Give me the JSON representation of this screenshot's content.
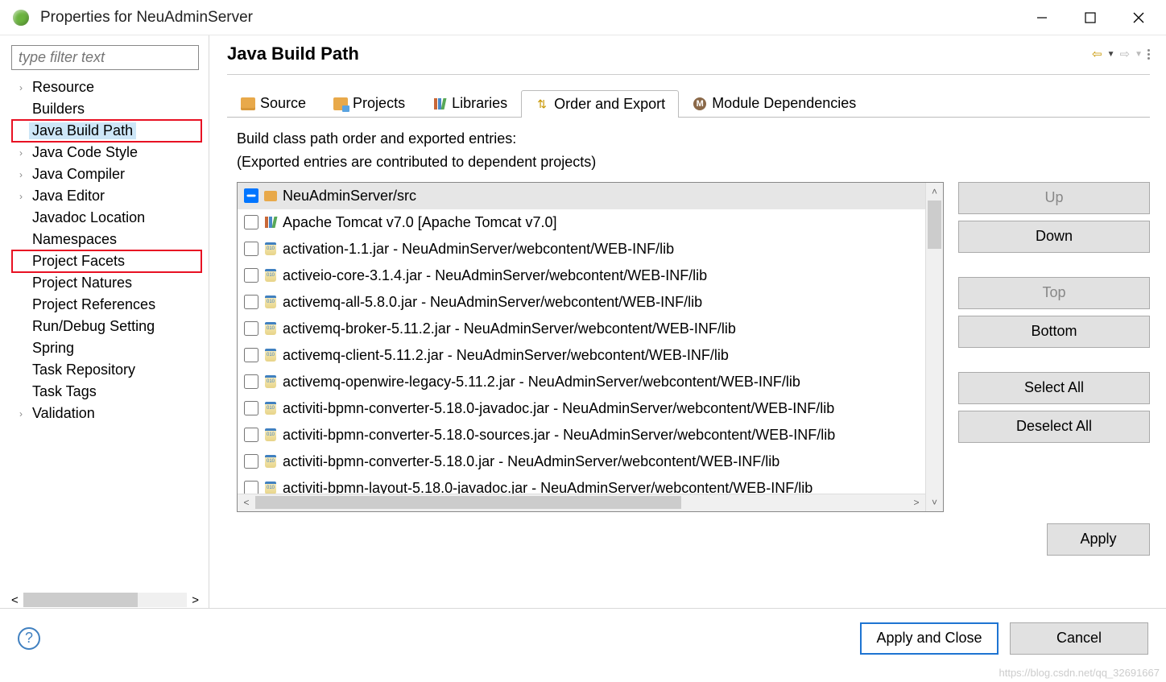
{
  "window": {
    "title": "Properties for NeuAdminServer"
  },
  "sidebar": {
    "filter_placeholder": "type filter text",
    "items": [
      {
        "label": "Resource",
        "expandable": true
      },
      {
        "label": "Builders",
        "expandable": false
      },
      {
        "label": "Java Build Path",
        "expandable": false,
        "selected": true,
        "highlight": true
      },
      {
        "label": "Java Code Style",
        "expandable": true
      },
      {
        "label": "Java Compiler",
        "expandable": true
      },
      {
        "label": "Java Editor",
        "expandable": true
      },
      {
        "label": "Javadoc Location",
        "expandable": false
      },
      {
        "label": "Namespaces",
        "expandable": false
      },
      {
        "label": "Project Facets",
        "expandable": false,
        "highlight": true
      },
      {
        "label": "Project Natures",
        "expandable": false
      },
      {
        "label": "Project References",
        "expandable": false
      },
      {
        "label": "Run/Debug Setting",
        "expandable": false
      },
      {
        "label": "Spring",
        "expandable": false
      },
      {
        "label": "Task Repository",
        "expandable": false
      },
      {
        "label": "Task Tags",
        "expandable": false
      },
      {
        "label": "Validation",
        "expandable": true
      }
    ]
  },
  "page": {
    "title": "Java Build Path",
    "tabs": [
      {
        "label": "Source",
        "icon": "folder"
      },
      {
        "label": "Projects",
        "icon": "projects"
      },
      {
        "label": "Libraries",
        "icon": "lib"
      },
      {
        "label": "Order and Export",
        "icon": "order",
        "active": true
      },
      {
        "label": "Module Dependencies",
        "icon": "mod"
      }
    ],
    "instruction_line1": "Build class path order and exported entries:",
    "instruction_line2": "(Exported entries are contributed to dependent projects)"
  },
  "entries": [
    {
      "label": "NeuAdminServer/src",
      "icon": "pkg",
      "chk": "indet",
      "sel": true
    },
    {
      "label": "Apache Tomcat v7.0 [Apache Tomcat v7.0]",
      "icon": "lib",
      "chk": "off"
    },
    {
      "label": "activation-1.1.jar - NeuAdminServer/webcontent/WEB-INF/lib",
      "icon": "jar",
      "chk": "off"
    },
    {
      "label": "activeio-core-3.1.4.jar - NeuAdminServer/webcontent/WEB-INF/lib",
      "icon": "jar",
      "chk": "off"
    },
    {
      "label": "activemq-all-5.8.0.jar - NeuAdminServer/webcontent/WEB-INF/lib",
      "icon": "jar",
      "chk": "off"
    },
    {
      "label": "activemq-broker-5.11.2.jar - NeuAdminServer/webcontent/WEB-INF/lib",
      "icon": "jar",
      "chk": "off"
    },
    {
      "label": "activemq-client-5.11.2.jar - NeuAdminServer/webcontent/WEB-INF/lib",
      "icon": "jar",
      "chk": "off"
    },
    {
      "label": "activemq-openwire-legacy-5.11.2.jar - NeuAdminServer/webcontent/WEB-INF/lib",
      "icon": "jar",
      "chk": "off"
    },
    {
      "label": "activiti-bpmn-converter-5.18.0-javadoc.jar - NeuAdminServer/webcontent/WEB-INF/lib",
      "icon": "jar",
      "chk": "off"
    },
    {
      "label": "activiti-bpmn-converter-5.18.0-sources.jar - NeuAdminServer/webcontent/WEB-INF/lib",
      "icon": "jar",
      "chk": "off"
    },
    {
      "label": "activiti-bpmn-converter-5.18.0.jar - NeuAdminServer/webcontent/WEB-INF/lib",
      "icon": "jar",
      "chk": "off"
    },
    {
      "label": "activiti-bpmn-layout-5.18.0-javadoc.jar - NeuAdminServer/webcontent/WEB-INF/lib",
      "icon": "jar",
      "chk": "off"
    }
  ],
  "buttons": {
    "up": "Up",
    "down": "Down",
    "top": "Top",
    "bottom": "Bottom",
    "select_all": "Select All",
    "deselect_all": "Deselect All",
    "apply": "Apply",
    "apply_close": "Apply and Close",
    "cancel": "Cancel"
  },
  "watermark": "https://blog.csdn.net/qq_32691667"
}
